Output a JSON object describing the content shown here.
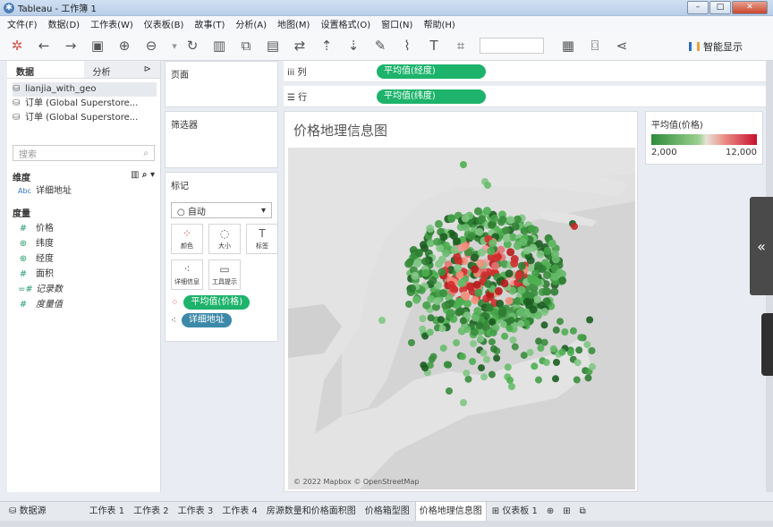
{
  "window": {
    "title": "Tableau - 工作簿 1",
    "minimize": "–",
    "maximize": "□",
    "close": "✕"
  },
  "menu": [
    "文件(F)",
    "数据(D)",
    "工作表(W)",
    "仪表板(B)",
    "故事(T)",
    "分析(A)",
    "地图(M)",
    "设置格式(O)",
    "窗口(N)",
    "帮助(H)"
  ],
  "toolbar": {
    "show_me": "智能显示"
  },
  "left_panel": {
    "tab_data": "数据",
    "tab_analysis": "分析",
    "sources": [
      "lianjia_with_geo",
      "订单 (Global Superstore...",
      "订单 (Global Superstore..."
    ],
    "search_placeholder": "搜索",
    "dimensions_label": "维度",
    "dimensions": [
      {
        "icon": "Abc",
        "name": "详细地址"
      }
    ],
    "measures_label": "度量",
    "measures": [
      {
        "icon": "#",
        "name": "价格"
      },
      {
        "icon": "globe",
        "name": "纬度"
      },
      {
        "icon": "globe",
        "name": "经度"
      },
      {
        "icon": "#",
        "name": "面积"
      },
      {
        "icon": "=#",
        "name": "记录数"
      },
      {
        "icon": "#",
        "name": "度量值"
      }
    ]
  },
  "pages": {
    "label": "页面"
  },
  "filters": {
    "label": "筛选器"
  },
  "marks": {
    "label": "标记",
    "type": "自动",
    "buttons": [
      "颜色",
      "大小",
      "标签",
      "详细信息",
      "工具提示"
    ],
    "pills": [
      {
        "label": "平均值(价格)",
        "color": "#1db36b"
      },
      {
        "label": "详细地址",
        "color": "#3c89a8"
      }
    ]
  },
  "shelves": {
    "columns_label": "列",
    "columns_pill": "平均值(经度)",
    "rows_label": "行",
    "rows_pill": "平均值(纬度)"
  },
  "viz": {
    "title": "价格地理信息图",
    "attribution": "© 2022 Mapbox © OpenStreetMap"
  },
  "legend": {
    "title": "平均值(价格)",
    "min": "2,000",
    "max": "12,000",
    "low_color": "#2e8b3a",
    "high_color": "#c8102e"
  },
  "sheet_tabs": [
    "数据源",
    "工作表 1",
    "工作表 2",
    "工作表 3",
    "工作表 4",
    "房源数量和价格面积图",
    "价格箱型图",
    "价格地理信息图",
    "仪表板 1"
  ],
  "active_tab": "价格地理信息图",
  "side_toggle": "«"
}
